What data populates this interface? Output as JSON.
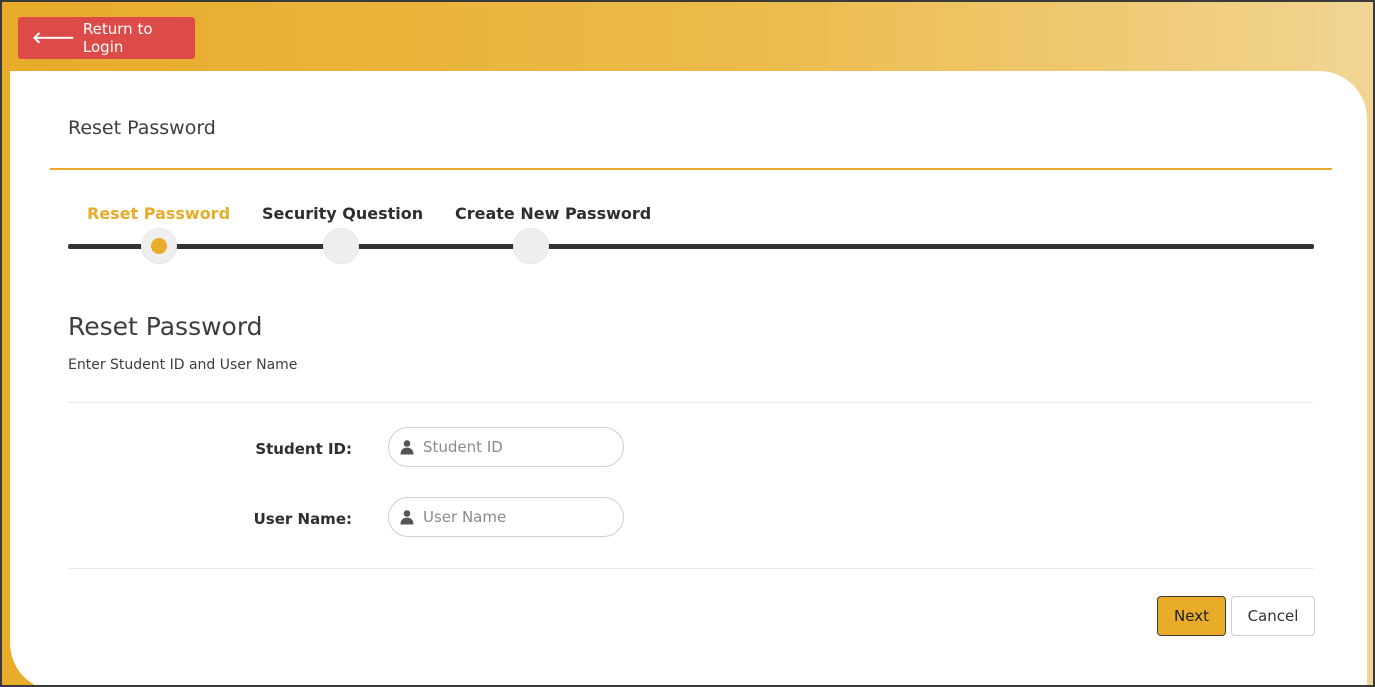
{
  "header": {
    "return_label": "Return to Login",
    "return_icon": "arrow-left-icon"
  },
  "panel": {
    "title": "Reset Password"
  },
  "steps": [
    {
      "label": "Reset Password",
      "active": true
    },
    {
      "label": "Security Question",
      "active": false
    },
    {
      "label": "Create New Password",
      "active": false
    }
  ],
  "form": {
    "title": "Reset Password",
    "subtitle": "Enter Student ID and User Name",
    "student_id": {
      "label": "Student ID:",
      "placeholder": "Student ID",
      "value": "",
      "icon": "user-icon"
    },
    "user_name": {
      "label": "User Name:",
      "placeholder": "User Name",
      "value": "",
      "icon": "user-icon"
    }
  },
  "actions": {
    "next_label": "Next",
    "cancel_label": "Cancel"
  },
  "colors": {
    "accent": "#e8ab2a",
    "danger": "#dc4b48",
    "text": "#3d3d3d"
  }
}
